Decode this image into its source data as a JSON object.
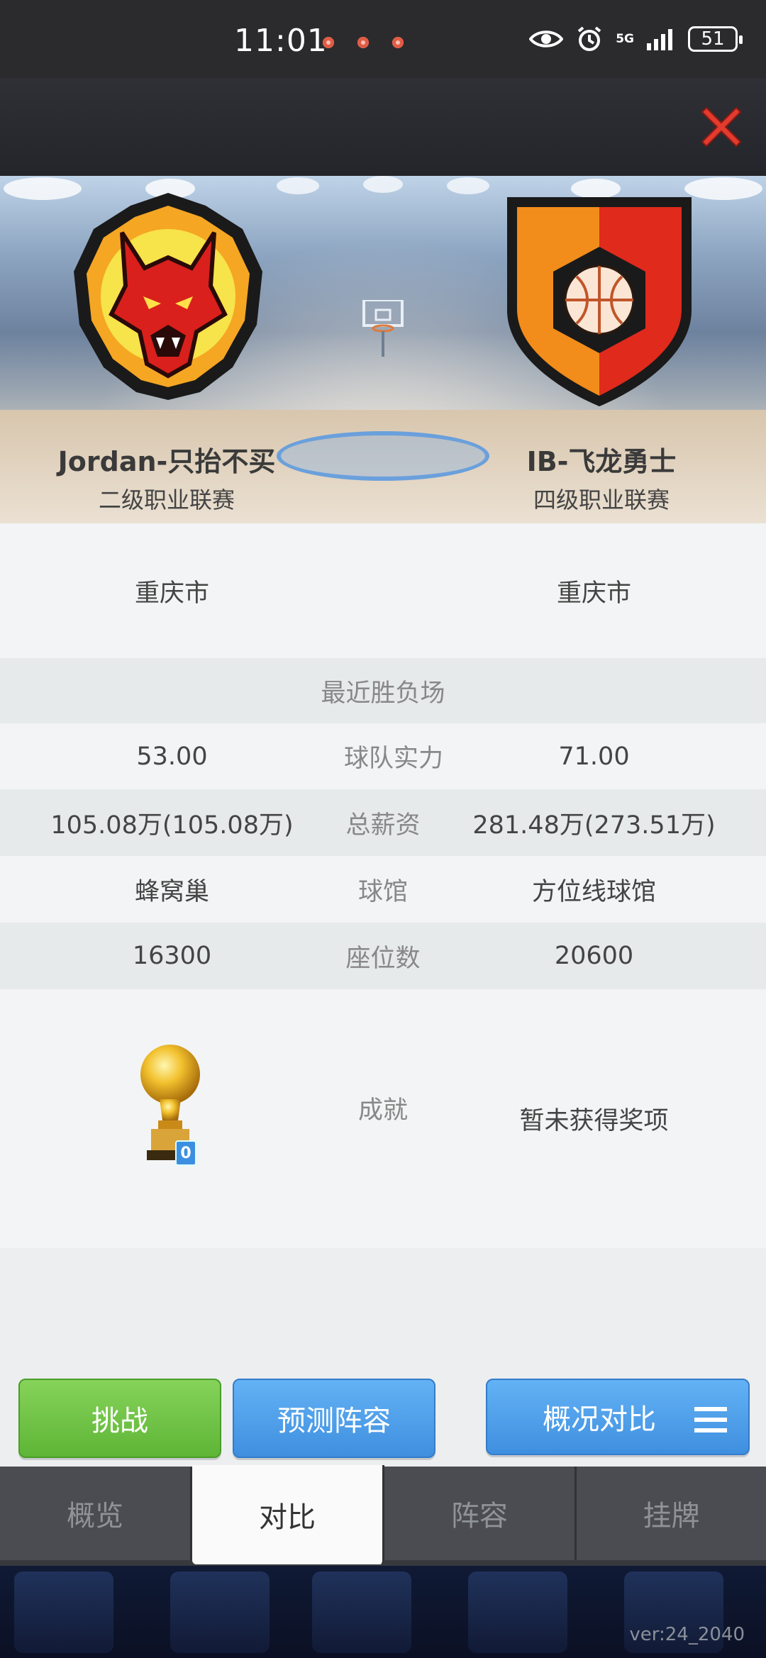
{
  "status_bar": {
    "time": "11:01",
    "network": "5G",
    "battery": "51"
  },
  "teams": {
    "home": {
      "name": "Jordan-只抬不买",
      "league": "二级职业联赛",
      "city": "重庆市",
      "strength": "53.00",
      "salary": "105.08万(105.08万)",
      "arena": "蜂窝巢",
      "seats": "16300",
      "trophy_count": "0"
    },
    "away": {
      "name": "IB-飞龙勇士",
      "league": "四级职业联赛",
      "city": "重庆市",
      "strength": "71.00",
      "salary": "281.48万(273.51万)",
      "arena": "方位线球馆",
      "seats": "20600",
      "achievement": "暂未获得奖项"
    }
  },
  "labels": {
    "recent": "最近胜负场",
    "strength": "球队实力",
    "salary": "总薪资",
    "arena": "球馆",
    "seats": "座位数",
    "achievement": "成就"
  },
  "actions": {
    "challenge": "挑战",
    "predict": "预测阵容",
    "compare": "概况对比"
  },
  "tabs": [
    {
      "label": "概览"
    },
    {
      "label": "对比",
      "active": true
    },
    {
      "label": "阵容"
    },
    {
      "label": "挂牌"
    }
  ],
  "version": "ver:24_2040",
  "colors": {
    "challenge_green": "#5eb536",
    "action_blue": "#3f8fe0",
    "close_red": "#e33b2e"
  }
}
